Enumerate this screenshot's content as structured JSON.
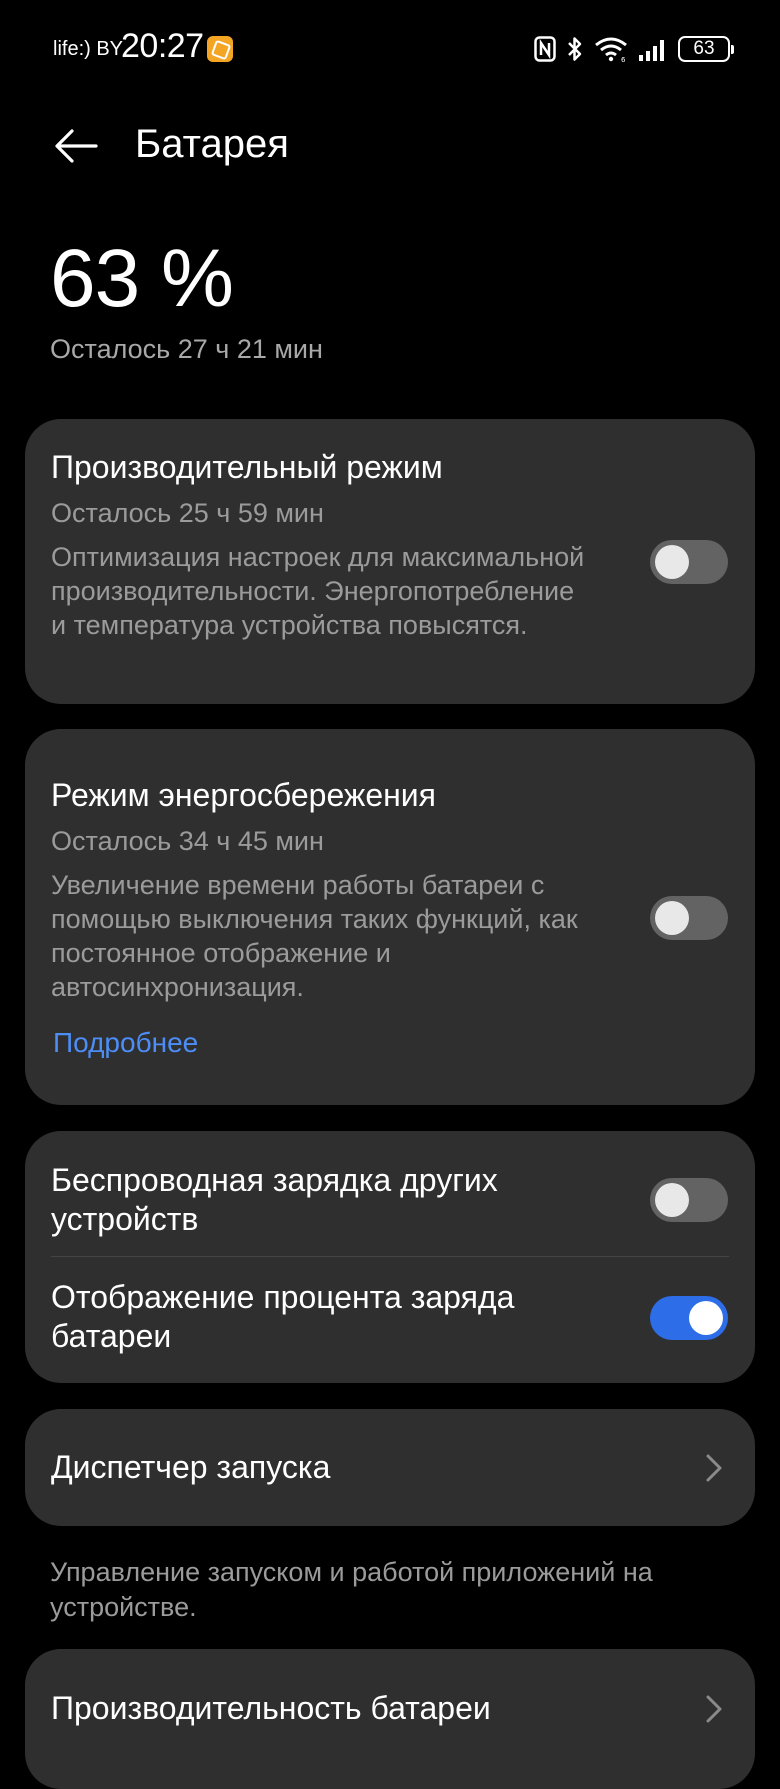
{
  "status_bar": {
    "carrier": "life:) BY",
    "time": "20:27",
    "battery_level": "63",
    "icons": [
      "nfc-icon",
      "bluetooth-icon",
      "wifi-icon",
      "signal-icon",
      "battery-icon"
    ]
  },
  "header": {
    "title": "Батарея"
  },
  "summary": {
    "percent": "63 %",
    "remaining": "Осталось 27 ч 21 мин"
  },
  "performance_mode": {
    "title": "Производительный режим",
    "remaining": "Осталось 25 ч 59 мин",
    "description": "Оптимизация настроек для максимальной производительности. Энергопотребление и температура устройства повысятся.",
    "enabled": false
  },
  "power_saving": {
    "title": "Режим энергосбережения",
    "remaining": "Осталось 34 ч 45 мин",
    "description": "Увеличение времени работы батареи с помощью выключения таких функций, как постоянное отображение и автосинхронизация.",
    "link": "Подробнее",
    "enabled": false
  },
  "toggles": {
    "wireless_reverse": {
      "label": "Беспроводная зарядка других устройств",
      "enabled": false
    },
    "battery_percent": {
      "label": "Отображение процента заряда батареи",
      "enabled": true
    }
  },
  "launch_manager": {
    "label": "Диспетчер запуска",
    "footnote": "Управление запуском и работой приложений на устройстве."
  },
  "battery_performance": {
    "label": "Производительность батареи"
  },
  "colors": {
    "background": "#000000",
    "card": "#2f2f2f",
    "accent": "#2d6de8",
    "link": "#4c8df6",
    "secondary_text": "#9b9b9b"
  }
}
